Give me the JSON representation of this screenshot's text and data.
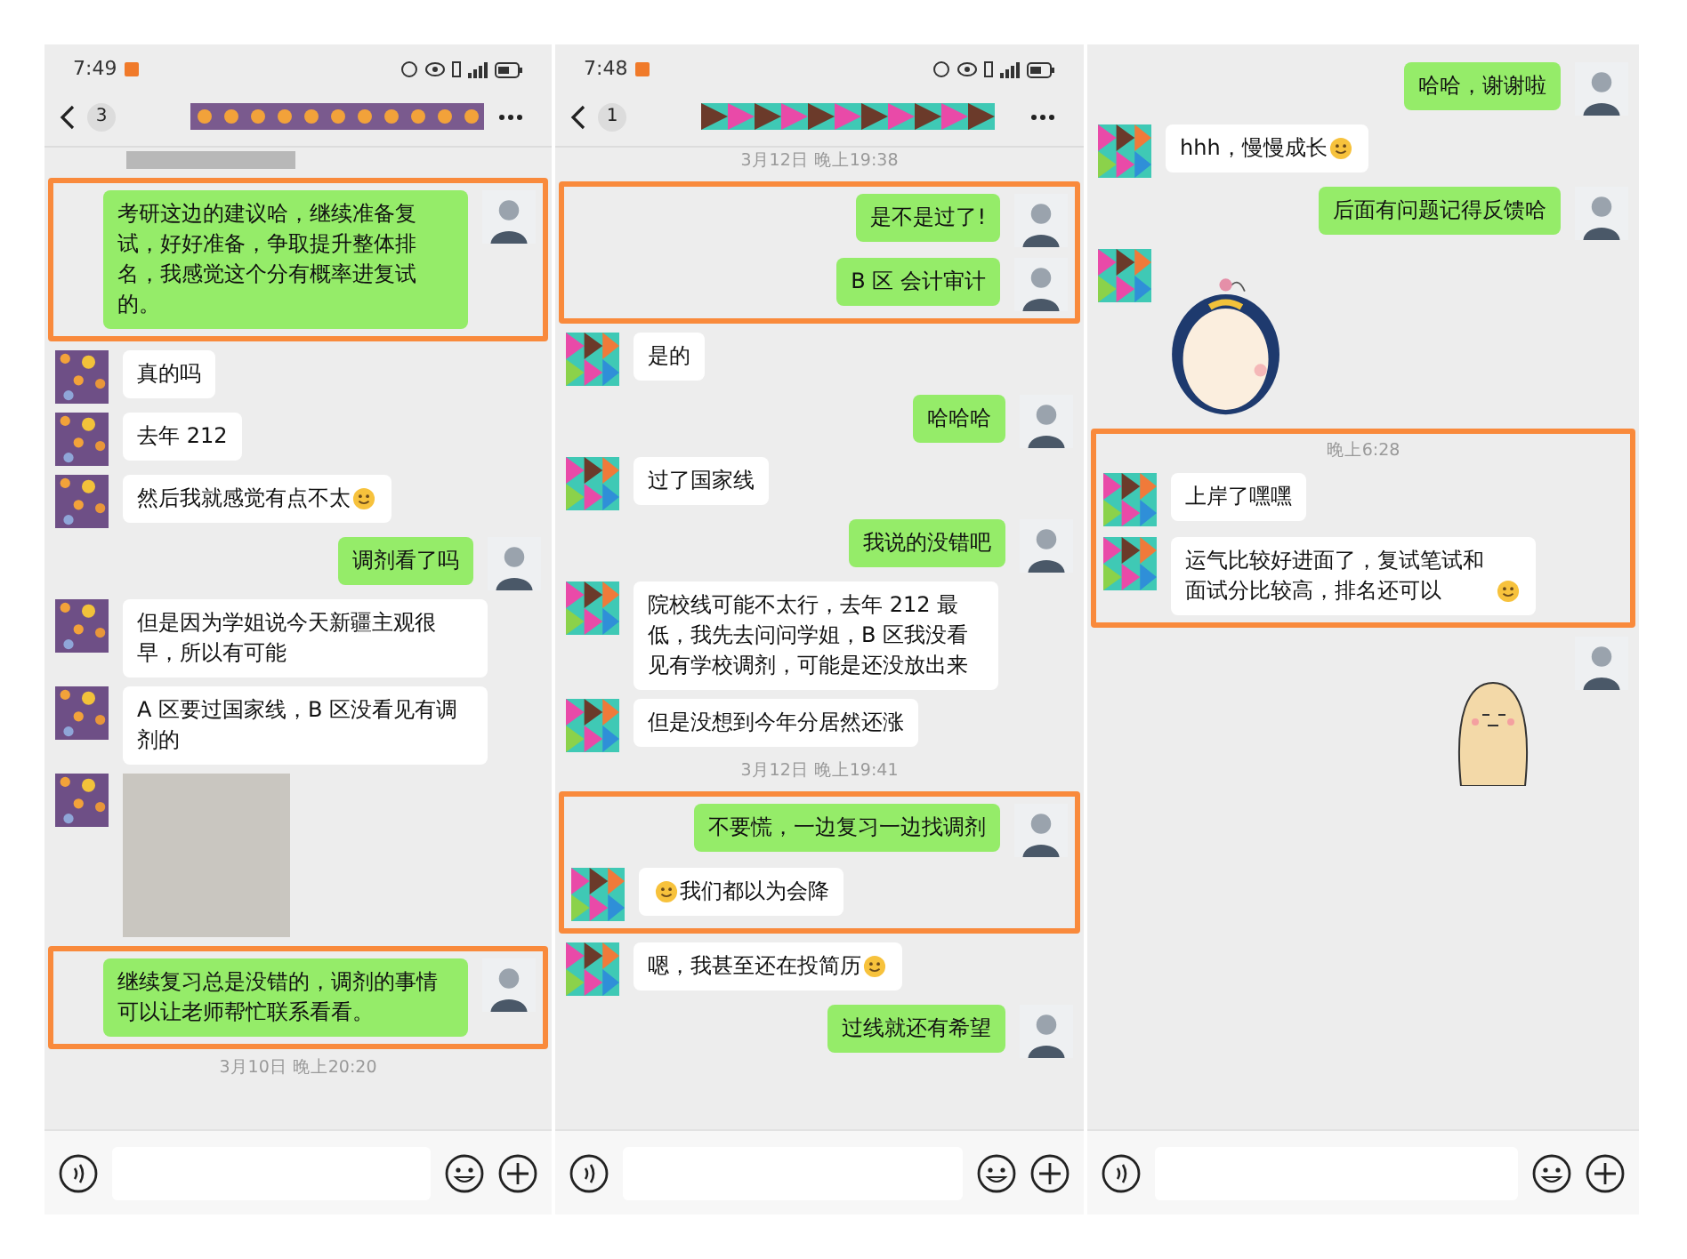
{
  "panels": [
    {
      "status_bar": {
        "time": "7:49"
      },
      "header": {
        "unread_count": "3"
      },
      "kind": "flowers",
      "messages": [
        {
          "kind": "image_fragment"
        },
        {
          "kind": "highlight",
          "messages": [
            {
              "kind": "text",
              "mine": true,
              "text": "考研这边的建议哈，继续准备复试，好好准备，争取提升整体排名，我感觉这个分有概率进复试的。"
            }
          ]
        },
        {
          "kind": "text",
          "mine": false,
          "text": "真的吗"
        },
        {
          "kind": "text",
          "mine": false,
          "text": "去年 212"
        },
        {
          "kind": "text",
          "mine": false,
          "text": "然后我就感觉有点不太",
          "emoji_after": true
        },
        {
          "kind": "text",
          "mine": true,
          "text": "调剂看了吗"
        },
        {
          "kind": "text",
          "mine": false,
          "text": "但是因为学姐说今天新疆主观很早，所以有可能"
        },
        {
          "kind": "text",
          "mine": false,
          "text": "A 区要过国家线，B 区没看见有调剂的"
        },
        {
          "kind": "photo"
        },
        {
          "kind": "highlight",
          "messages": [
            {
              "kind": "text",
              "mine": true,
              "text": "继续复习总是没错的，调剂的事情可以让老师帮忙联系看看。"
            }
          ]
        },
        {
          "kind": "timestamp",
          "text": "3月10日 晚上20:20"
        }
      ]
    },
    {
      "status_bar": {
        "time": "7:48"
      },
      "header": {
        "unread_count": "1"
      },
      "kind": "triangles",
      "messages": [
        {
          "kind": "timestamp",
          "text": "3月12日 晚上19:38"
        },
        {
          "kind": "highlight",
          "messages": [
            {
              "kind": "text",
              "mine": true,
              "text": "是不是过了!"
            },
            {
              "kind": "text",
              "mine": true,
              "text": "B 区 会计审计"
            }
          ]
        },
        {
          "kind": "text",
          "mine": false,
          "text": "是的"
        },
        {
          "kind": "text",
          "mine": true,
          "text": "哈哈哈"
        },
        {
          "kind": "text",
          "mine": false,
          "text": "过了国家线"
        },
        {
          "kind": "text",
          "mine": true,
          "text": "我说的没错吧"
        },
        {
          "kind": "text",
          "mine": false,
          "text": "院校线可能不太行，去年 212 最低，我先去问问学姐，B 区我没看见有学校调剂，可能是还没放出来"
        },
        {
          "kind": "text",
          "mine": false,
          "text": "但是没想到今年分居然还涨"
        },
        {
          "kind": "timestamp",
          "text": "3月12日 晚上19:41"
        },
        {
          "kind": "highlight",
          "messages": [
            {
              "kind": "text",
              "mine": true,
              "text": "不要慌，一边复习一边找调剂"
            },
            {
              "kind": "text",
              "mine": false,
              "text": "我们都以为会降",
              "emoji_before": true
            }
          ]
        },
        {
          "kind": "text",
          "mine": false,
          "text": "嗯，我甚至还在投简历",
          "emoji_after": true
        },
        {
          "kind": "text",
          "mine": true,
          "text": "过线就还有希望"
        }
      ]
    },
    {
      "kind": "triangles",
      "messages": [
        {
          "kind": "text",
          "mine": true,
          "text": "哈哈，谢谢啦"
        },
        {
          "kind": "text",
          "mine": false,
          "text": "hhh，慢慢成长",
          "emoji_after": true
        },
        {
          "kind": "text",
          "mine": true,
          "text": "后面有问题记得反馈哈"
        },
        {
          "kind": "sticker",
          "mine": false
        },
        {
          "kind": "highlight",
          "messages": [
            {
              "kind": "timestamp",
              "text": "晚上6:28"
            },
            {
              "kind": "text",
              "mine": false,
              "text": "上岸了嘿嘿"
            },
            {
              "kind": "text",
              "mine": false,
              "text": "运气比较好进面了，复试笔试和面试分比较高，排名还可以",
              "emoji_after": true
            }
          ]
        },
        {
          "kind": "sticker",
          "mine": true
        }
      ]
    }
  ]
}
